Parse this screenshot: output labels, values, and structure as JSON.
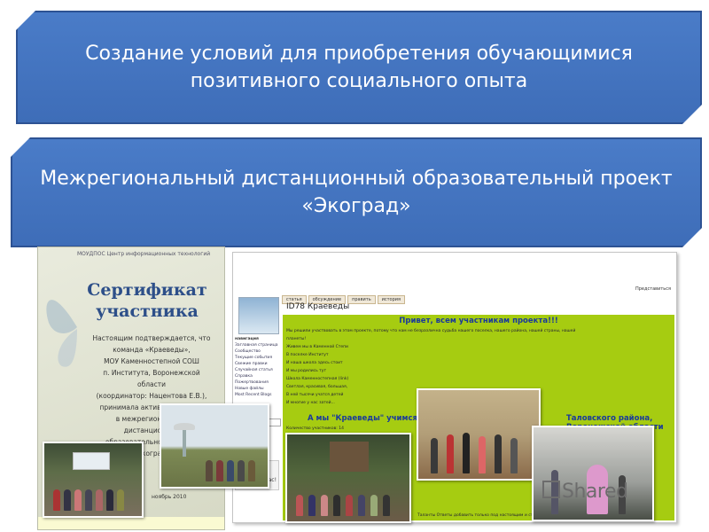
{
  "banners": {
    "top_line1": "Создание условий для приобретения обучающимися",
    "top_line2": "позитивного социального опыта",
    "project_line1": "Межрегиональный дистанционный образовательный проект",
    "project_line2": "«Экоград»"
  },
  "certificate": {
    "header": "МОУДПОС Центр информационных технологий",
    "title_line1": "Сертификат",
    "title_line2": "участника",
    "body_lines": [
      "Настоящим подтверждается, что",
      "команда «Краеведы»,",
      "МОУ Каменностепной СОШ",
      "п. Института, Воронежской области",
      "(координатор: Нацентова Е.В.),",
      "принимала активное участие",
      "в межрегиональном дистанционном",
      "образовательном проекте",
      "«Экоград»"
    ],
    "date": "ноябрь 2010"
  },
  "website": {
    "tabs": [
      "статья",
      "обсуждение",
      "править",
      "история"
    ],
    "login_link": "Представиться",
    "page_title": "ID78 Краеведы",
    "nav_header": "навигация",
    "nav_items": [
      "Заглавная страница",
      "Сообщество",
      "Текущие события",
      "Свежие правки",
      "Случайная статья",
      "Справка",
      "Пожертвования",
      "Новые файлы",
      "Most Recent Blogs"
    ],
    "search_label": "поиск",
    "hello_heading": "Привет, всем участникам проекта!!!",
    "content_lines": [
      "Мы решили участвовать в этом проекте, потому что нам не безразлична судьба нашего поселка, нашего района, нашей страны, нашей планеты!",
      "Живем мы в Каменной Степи",
      "В поселке Институт",
      "И наша школа здесь стоит",
      "И мы родились тут",
      "Школа Каменностепная (link)",
      "Светлая, красивая, большая,",
      "В ней тысячи учатся детей",
      "И многие у нас затей..."
    ],
    "class_line_start": "А мы \"Краеведы\" учимся в 5 \"а\"",
    "class_line_end": "Таловского района, Воронежской области",
    "count_line": "Количество участников: 14",
    "bottom_line": "Таланты  Ответы  добавить только под настоящим и старанием",
    "side_badge": "ass ас!"
  },
  "watermark": "Shared"
}
